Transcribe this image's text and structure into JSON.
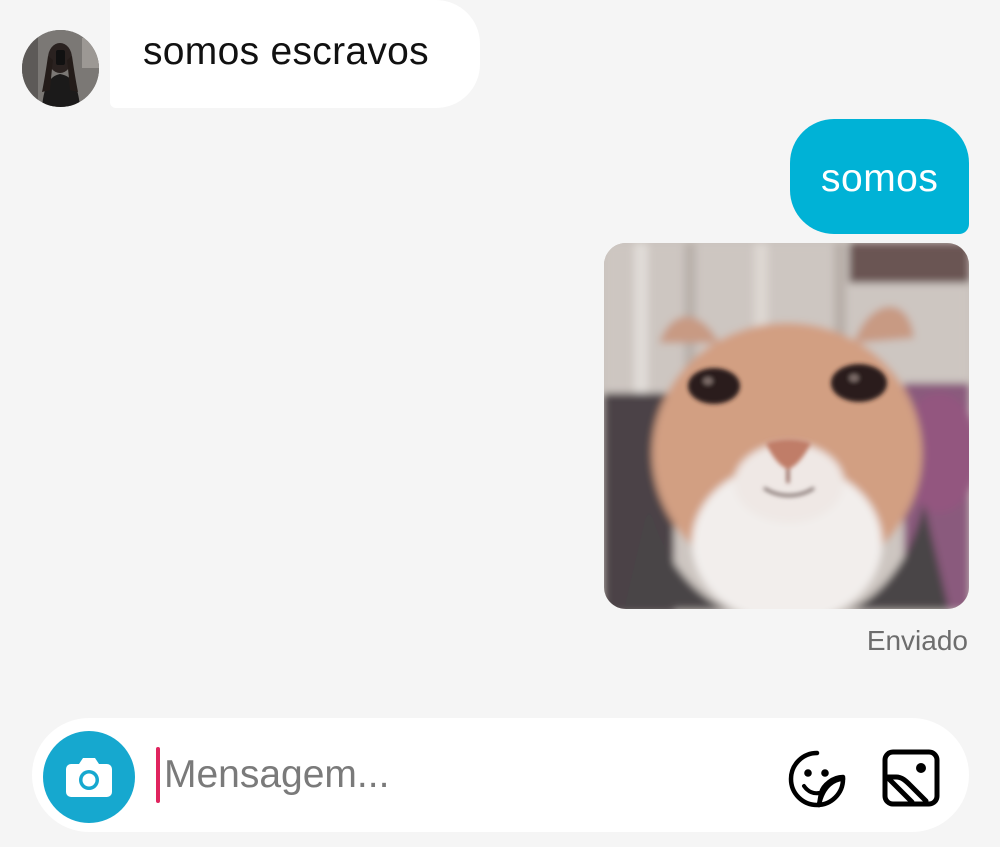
{
  "conversation": {
    "messages": [
      {
        "direction": "incoming",
        "type": "text",
        "text": "somos escravos"
      },
      {
        "direction": "outgoing",
        "type": "text",
        "text": "somos"
      },
      {
        "direction": "outgoing",
        "type": "image"
      }
    ],
    "status": "Enviado"
  },
  "composer": {
    "placeholder": "Mensagem...",
    "value": ""
  },
  "icons": {
    "camera": "camera-icon",
    "sticker": "sticker-icon",
    "gallery": "gallery-icon"
  },
  "colors": {
    "background": "#f5f5f5",
    "outgoing_bubble": "#00b2d6",
    "incoming_bubble": "#ffffff",
    "camera_button": "#16a8cf",
    "caret": "#e0245e"
  }
}
